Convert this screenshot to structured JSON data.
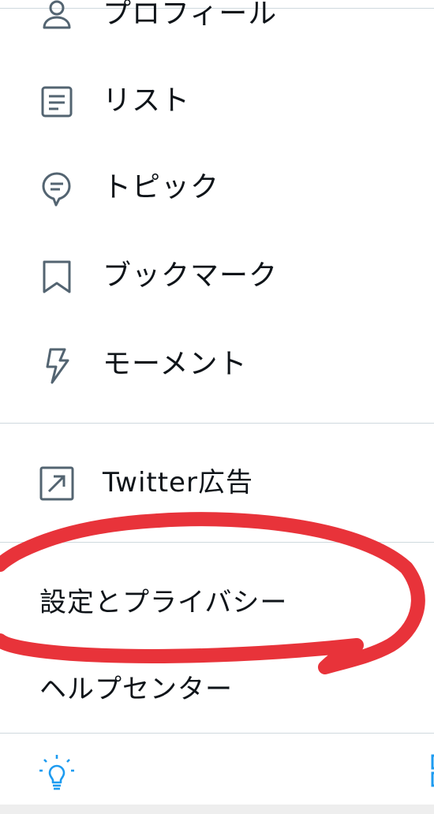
{
  "menu": {
    "items": [
      {
        "label": "プロフィール",
        "icon": "person-icon"
      },
      {
        "label": "リスト",
        "icon": "list-icon"
      },
      {
        "label": "トピック",
        "icon": "topic-icon"
      },
      {
        "label": "ブックマーク",
        "icon": "bookmark-icon"
      },
      {
        "label": "モーメント",
        "icon": "lightning-icon"
      }
    ],
    "ads": {
      "label": "Twitter広告",
      "icon": "external-arrow-icon"
    },
    "settings_label": "設定とプライバシー",
    "help_label": "ヘルプセンター"
  },
  "bottom_bar": {
    "left_icon": "lightbulb-icon",
    "right_icon": "qr-code-icon"
  },
  "colors": {
    "icon": "#536471",
    "divider": "#cfd9de",
    "accent": "#1d9bf0",
    "annotation": "#e8333a"
  }
}
